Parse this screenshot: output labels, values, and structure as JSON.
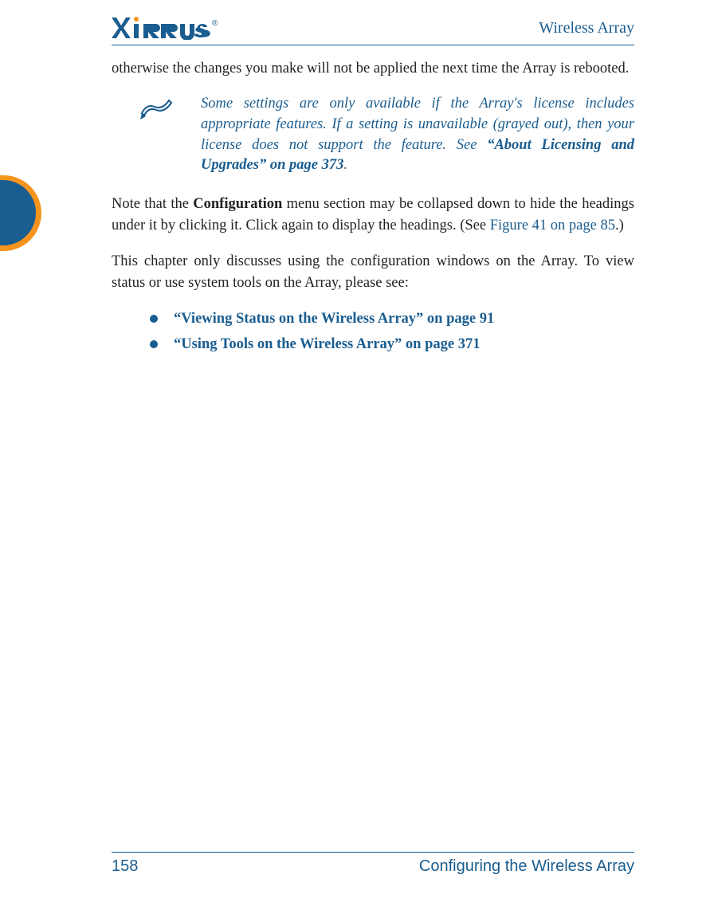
{
  "header": {
    "product": "Wireless Array",
    "logo_text": "XIRRUS"
  },
  "body": {
    "para1": "otherwise the changes you make will not be applied the next time the Array is rebooted.",
    "note_text_1": "Some settings are only available if the Array's license includes appropriate features. If a setting is unavailable (grayed out), then your license does not support the feature. See ",
    "note_bold": "“About Licensing and Upgrades” on page 373",
    "note_text_2": ".",
    "para2_a": "Note that the ",
    "para2_bold": "Configuration",
    "para2_b": " menu section may be collapsed down to hide the headings under it by clicking it. Click again to display the headings. (See ",
    "para2_link": "Figure 41 on page 85",
    "para2_c": ".)",
    "para3": "This chapter only discusses using the configuration windows on the Array. To view status or use system tools on the Array, please see:",
    "bullet1": "“Viewing Status on the Wireless Array” on page 91",
    "bullet2": "“Using Tools on the Wireless Array” on page 371"
  },
  "footer": {
    "page_number": "158",
    "section": "Configuring the Wireless Array"
  }
}
